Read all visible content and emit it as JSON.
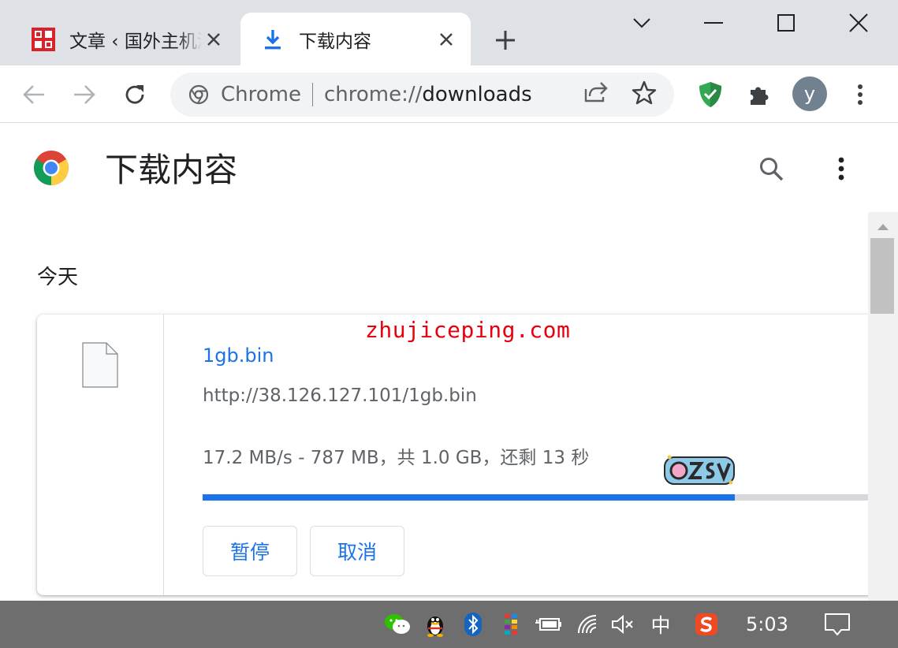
{
  "tabs": [
    {
      "title": "文章 ‹ 国外主机测评",
      "active": false,
      "favicon": "zhujiceping-seal-icon"
    },
    {
      "title": "下载内容",
      "active": true,
      "favicon": "download-arrow-icon"
    }
  ],
  "omnibox": {
    "chip": "Chrome",
    "url_scheme": "chrome://",
    "url_path": "downloads"
  },
  "profile": {
    "initial": "y"
  },
  "page": {
    "title": "下载内容",
    "date_header": "今天"
  },
  "download": {
    "file_name": "1gb.bin",
    "url": "http://38.126.127.101/1gb.bin",
    "status": "17.2 MB/s - 787 MB，共 1.0 GB，还剩 13 秒",
    "progress_fraction": 0.776,
    "pause_label": "暂停",
    "cancel_label": "取消"
  },
  "watermark": "zhujiceping.com",
  "taskbar": {
    "ime": "中",
    "clock": "5:03"
  },
  "colors": {
    "accent": "#1a73e8",
    "watermark": "#e8000e",
    "tabstrip": "#dee1e6",
    "adguard": "#34a853"
  }
}
